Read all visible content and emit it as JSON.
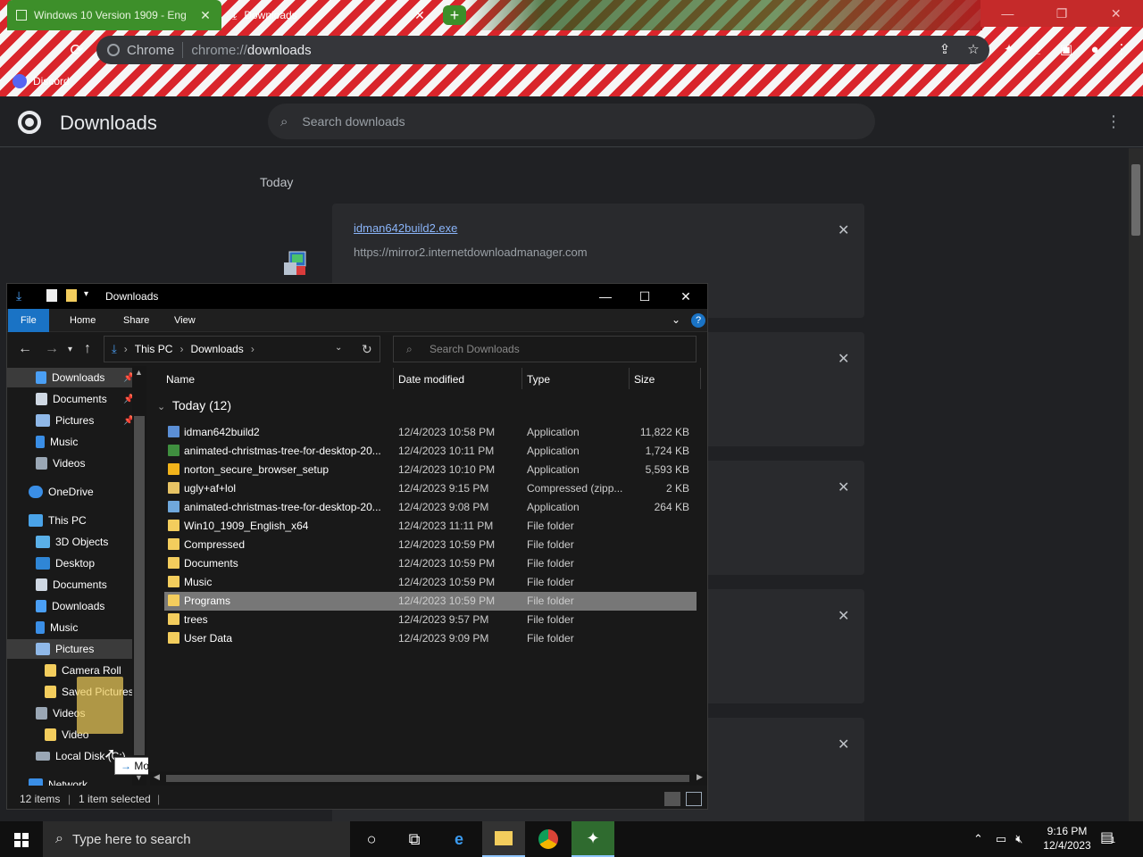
{
  "browser": {
    "tabs": [
      {
        "title": "Windows 10 Version 1909 - Eng",
        "close": "✕"
      },
      {
        "title": "Downloads",
        "close": "✕"
      }
    ],
    "new_tab": "+",
    "window_controls": [
      "—",
      "❐",
      "✕"
    ],
    "omnibox": {
      "chip": "Chrome",
      "url_prefix": "chrome://",
      "url_path": "downloads"
    },
    "bookmarks": [
      {
        "label": "Discord"
      }
    ]
  },
  "downloads_page": {
    "title": "Downloads",
    "search_placeholder": "Search downloads",
    "menu": "⋮",
    "section": "Today",
    "items": [
      {
        "name": "idman642build2.exe",
        "url": "https://mirror2.internetdownloadmanager.com",
        "close": "✕"
      }
    ],
    "extra_close_buttons": [
      "✕",
      "✕",
      "✕",
      "✕"
    ]
  },
  "explorer": {
    "title": "Downloads",
    "window_controls": [
      "—",
      "☐",
      "✕"
    ],
    "ribbon_tabs": [
      "File",
      "Home",
      "Share",
      "View"
    ],
    "help": "?",
    "address": {
      "crumbs": [
        "This PC",
        "Downloads"
      ]
    },
    "search_placeholder": "Search Downloads",
    "nav_pane": [
      {
        "label": "Downloads",
        "pinned": true
      },
      {
        "label": "Documents",
        "pinned": true
      },
      {
        "label": "Pictures",
        "pinned": true
      },
      {
        "label": "Music"
      },
      {
        "label": "Videos"
      },
      {
        "label": "OneDrive"
      },
      {
        "label": "This PC"
      },
      {
        "label": "3D Objects"
      },
      {
        "label": "Desktop"
      },
      {
        "label": "Documents"
      },
      {
        "label": "Downloads"
      },
      {
        "label": "Music"
      },
      {
        "label": "Pictures"
      },
      {
        "label": "Camera Roll"
      },
      {
        "label": "Saved Pictures"
      },
      {
        "label": "Videos"
      },
      {
        "label": "Video"
      },
      {
        "label": "Local Disk (C:)"
      },
      {
        "label": "Network"
      }
    ],
    "drag_tooltip": "Move to Pictures",
    "columns": [
      "Name",
      "Date modified",
      "Type",
      "Size"
    ],
    "group": "Today (12)",
    "files": [
      {
        "name": "idman642build2",
        "date": "12/4/2023 10:58 PM",
        "type": "Application",
        "size": "11,822 KB",
        "icon": "app-icon",
        "color": "#5b8fd6"
      },
      {
        "name": "animated-christmas-tree-for-desktop-20...",
        "date": "12/4/2023 10:11 PM",
        "type": "Application",
        "size": "1,724 KB",
        "icon": "tree-app-icon",
        "color": "#3f8f3f"
      },
      {
        "name": "norton_secure_browser_setup",
        "date": "12/4/2023 10:10 PM",
        "type": "Application",
        "size": "5,593 KB",
        "icon": "norton-icon",
        "color": "#f2b41b"
      },
      {
        "name": "ugly+af+lol",
        "date": "12/4/2023 9:15 PM",
        "type": "Compressed (zipp...",
        "size": "2 KB",
        "icon": "zip-icon",
        "color": "#e8c465"
      },
      {
        "name": "animated-christmas-tree-for-desktop-20...",
        "date": "12/4/2023 9:08 PM",
        "type": "Application",
        "size": "264 KB",
        "icon": "app-icon",
        "color": "#6fa8dc"
      },
      {
        "name": "Win10_1909_English_x64",
        "date": "12/4/2023 11:11 PM",
        "type": "File folder",
        "size": "",
        "icon": "folder-icon",
        "color": "#f3cd5d"
      },
      {
        "name": "Compressed",
        "date": "12/4/2023 10:59 PM",
        "type": "File folder",
        "size": "",
        "icon": "folder-icon",
        "color": "#f3cd5d"
      },
      {
        "name": "Documents",
        "date": "12/4/2023 10:59 PM",
        "type": "File folder",
        "size": "",
        "icon": "folder-icon",
        "color": "#f3cd5d"
      },
      {
        "name": "Music",
        "date": "12/4/2023 10:59 PM",
        "type": "File folder",
        "size": "",
        "icon": "folder-icon",
        "color": "#f3cd5d"
      },
      {
        "name": "Programs",
        "date": "12/4/2023 10:59 PM",
        "type": "File folder",
        "size": "",
        "icon": "folder-icon",
        "color": "#f3cd5d",
        "selected": true
      },
      {
        "name": "trees",
        "date": "12/4/2023 9:57 PM",
        "type": "File folder",
        "size": "",
        "icon": "folder-icon",
        "color": "#f3cd5d"
      },
      {
        "name": "User Data",
        "date": "12/4/2023 9:09 PM",
        "type": "File folder",
        "size": "",
        "icon": "folder-icon",
        "color": "#f3cd5d"
      }
    ],
    "status": {
      "items": "12 items",
      "selected": "1 item selected"
    }
  },
  "taskbar": {
    "search_placeholder": "Type here to search",
    "apps": [
      "cortana-icon",
      "task-view-icon",
      "edge-icon",
      "file-explorer-icon",
      "chrome-icon",
      "christmas-tree-app-icon"
    ],
    "clock_time": "9:16 PM",
    "clock_date": "12/4/2023",
    "notification_count": "1"
  }
}
